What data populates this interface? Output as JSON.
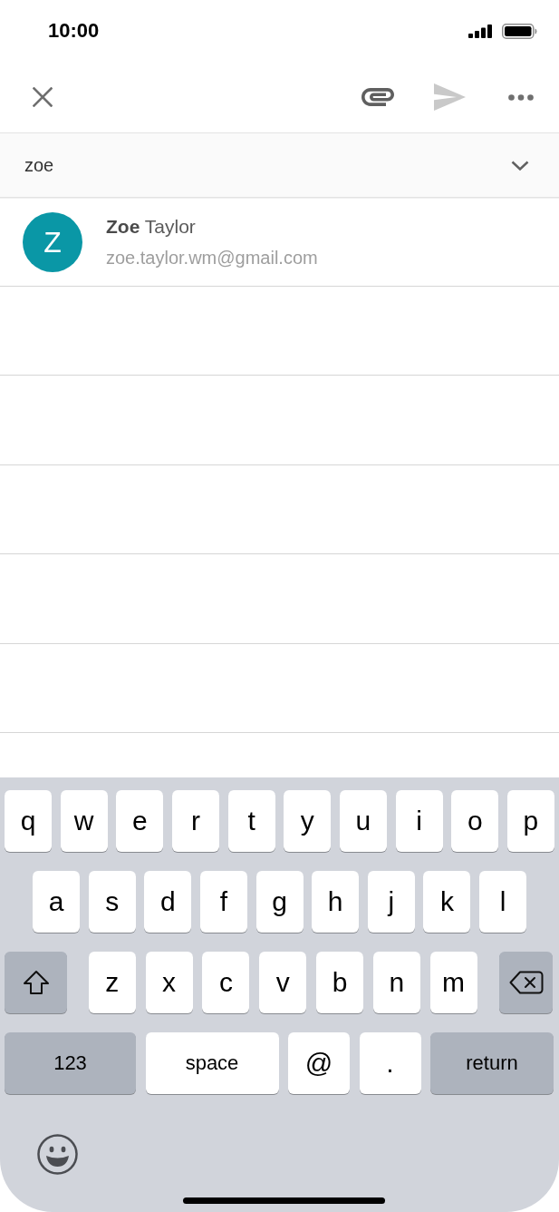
{
  "status_bar": {
    "time": "10:00"
  },
  "toolbar": {
    "actions": [
      {
        "kind": "close",
        "disabled": false
      },
      {
        "kind": "attach",
        "disabled": false
      },
      {
        "kind": "send",
        "disabled": true
      },
      {
        "kind": "more",
        "disabled": false
      }
    ]
  },
  "recipient_field": {
    "value": "zoe"
  },
  "suggestions": [
    {
      "initial": "Z",
      "name": "**Zoe** Taylor",
      "email": "zoe.taylor.wm@gmail.com"
    }
  ],
  "keyboard": {
    "letter_rows": [
      [
        {
          "kind": "letter",
          "label": "q"
        },
        {
          "kind": "letter",
          "label": "w"
        },
        {
          "kind": "letter",
          "label": "e"
        },
        {
          "kind": "letter",
          "label": "r"
        },
        {
          "kind": "letter",
          "label": "t"
        },
        {
          "kind": "letter",
          "label": "y"
        },
        {
          "kind": "letter",
          "label": "u"
        },
        {
          "kind": "letter",
          "label": "i"
        },
        {
          "kind": "letter",
          "label": "o"
        },
        {
          "kind": "letter",
          "label": "p"
        }
      ],
      [
        {
          "kind": "letter",
          "label": "a"
        },
        {
          "kind": "letter",
          "label": "s"
        },
        {
          "kind": "letter",
          "label": "d"
        },
        {
          "kind": "letter",
          "label": "f"
        },
        {
          "kind": "letter",
          "label": "g"
        },
        {
          "kind": "letter",
          "label": "h"
        },
        {
          "kind": "letter",
          "label": "j"
        },
        {
          "kind": "letter",
          "label": "k"
        },
        {
          "kind": "letter",
          "label": "l"
        }
      ],
      [
        {
          "kind": "shift"
        },
        {
          "kind": "letter",
          "label": "z"
        },
        {
          "kind": "letter",
          "label": "x"
        },
        {
          "kind": "letter",
          "label": "c"
        },
        {
          "kind": "letter",
          "label": "v"
        },
        {
          "kind": "letter",
          "label": "b"
        },
        {
          "kind": "letter",
          "label": "n"
        },
        {
          "kind": "letter",
          "label": "m"
        },
        {
          "kind": "backspace"
        }
      ]
    ],
    "bottom_row": [
      {
        "kind": "mode",
        "label": "123"
      },
      {
        "kind": "space",
        "label": "space"
      },
      {
        "kind": "letter",
        "label": "@"
      },
      {
        "kind": "letter",
        "label": "."
      },
      {
        "kind": "return",
        "label": "return"
      }
    ]
  }
}
